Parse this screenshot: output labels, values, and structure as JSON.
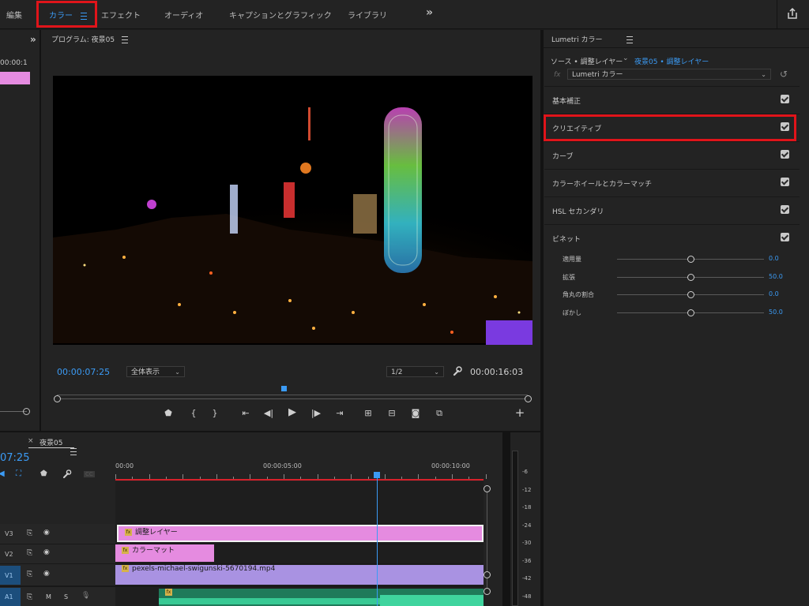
{
  "workspaces": {
    "edit": "編集",
    "color": "カラー",
    "effects": "エフェクト",
    "audio": "オーディオ",
    "captions": "キャプションとグラフィック",
    "libraries": "ライブラリ",
    "more": "»"
  },
  "left_panel": {
    "timecode_fragment": "00:00:1"
  },
  "program": {
    "title": "プログラム: 夜景05",
    "current_timecode": "00:00:07:25",
    "fit_label": "全体表示",
    "resolution": "1/2",
    "duration": "00:00:16:03"
  },
  "lumetri": {
    "title": "Lumetri カラー",
    "source_label": "ソース • 調整レイヤー",
    "sequence_label": "夜景05 • 調整レイヤー",
    "fx_label": "fx",
    "effect_name": "Lumetri カラー",
    "sections": [
      {
        "label": "基本補正",
        "checked": true
      },
      {
        "label": "クリエイティブ",
        "checked": true
      },
      {
        "label": "カーブ",
        "checked": true
      },
      {
        "label": "カラーホイールとカラーマッチ",
        "checked": true
      },
      {
        "label": "HSL セカンダリ",
        "checked": true
      },
      {
        "label": "ビネット",
        "checked": true
      }
    ],
    "vignette": [
      {
        "label": "適用量",
        "value": "0.0",
        "level": 0.5
      },
      {
        "label": "拡張",
        "value": "50.0",
        "level": 0.5
      },
      {
        "label": "角丸の割合",
        "value": "0.0",
        "level": 0.5
      },
      {
        "label": "ぼかし",
        "value": "50.0",
        "level": 0.5
      }
    ]
  },
  "timeline": {
    "tab_close": "×",
    "sequence_name": "夜景05",
    "timecode": "07:25",
    "ruler": [
      "00:00",
      "00:00:05:00",
      "00:00:10:00"
    ],
    "tracks": [
      {
        "name": "V3",
        "clip": "調整レイヤー"
      },
      {
        "name": "V2",
        "clip": "カラーマット"
      },
      {
        "name": "V1",
        "clip": "pexels-michael-swigunski-5670194.mp4"
      },
      {
        "name": "A1"
      }
    ],
    "audio_buttons": {
      "mute": "M",
      "solo": "S"
    },
    "cc_label": "CC"
  },
  "meter_ticks": [
    "-6",
    "-12",
    "-18",
    "-24",
    "-30",
    "-36",
    "-42",
    "-48"
  ],
  "colors": {
    "accent": "#3b9bf5",
    "highlight": "#e0141a",
    "adjustment_clip": "#e58be0",
    "video_clip": "#a992e2",
    "audio_clip": "#2fbf88"
  }
}
